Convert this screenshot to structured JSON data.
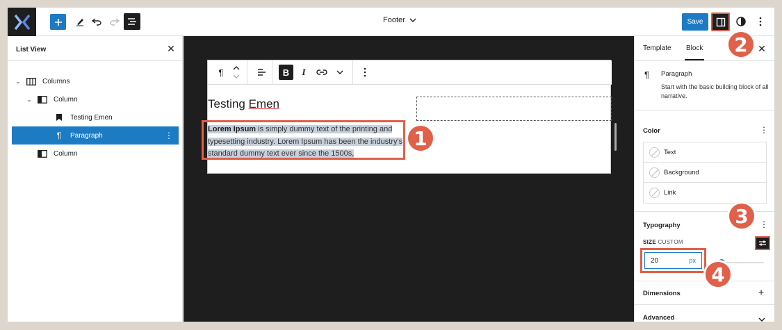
{
  "app": {
    "logo_icon": "logo-icon",
    "document_title": "Footer",
    "save_label": "Save",
    "accent_color": "#1d7bc4",
    "annotation_color": "#e0604a"
  },
  "list_view": {
    "title": "List View",
    "items": [
      {
        "label": "Columns",
        "icon": "columns-icon",
        "level": 0,
        "expanded": true
      },
      {
        "label": "Column",
        "icon": "column-icon",
        "level": 1,
        "expanded": true
      },
      {
        "label": "Testing Emen",
        "icon": "bookmark-icon",
        "level": 2
      },
      {
        "label": "Paragraph",
        "icon": "paragraph-icon",
        "level": 2,
        "selected": true
      },
      {
        "label": "Column",
        "icon": "column-icon",
        "level": 1
      }
    ]
  },
  "canvas": {
    "heading_prefix": "Testing ",
    "heading_underlined": "Emen",
    "paragraph_bold": "Lorem Ipsum",
    "paragraph_rest": " is simply dummy text of the printing and typesetting industry. Lorem Ipsum has been the industry's standard dummy text ever since the 1500s,"
  },
  "panel": {
    "tabs": [
      {
        "label": "Template"
      },
      {
        "label": "Block",
        "active": true
      }
    ],
    "block_title": "Paragraph",
    "block_description": "Start with the basic building block of all narrative.",
    "color_section": "Color",
    "color_items": [
      "Text",
      "Background",
      "Link"
    ],
    "typography_section": "Typography",
    "size_label_bold": "SIZE",
    "size_label_rest": "CUSTOM",
    "size_value": "20",
    "size_unit": "px",
    "size_slider_fraction": 0.2,
    "dimensions_section": "Dimensions",
    "advanced_section": "Advanced"
  },
  "badges": [
    "1",
    "2",
    "3",
    "4"
  ]
}
